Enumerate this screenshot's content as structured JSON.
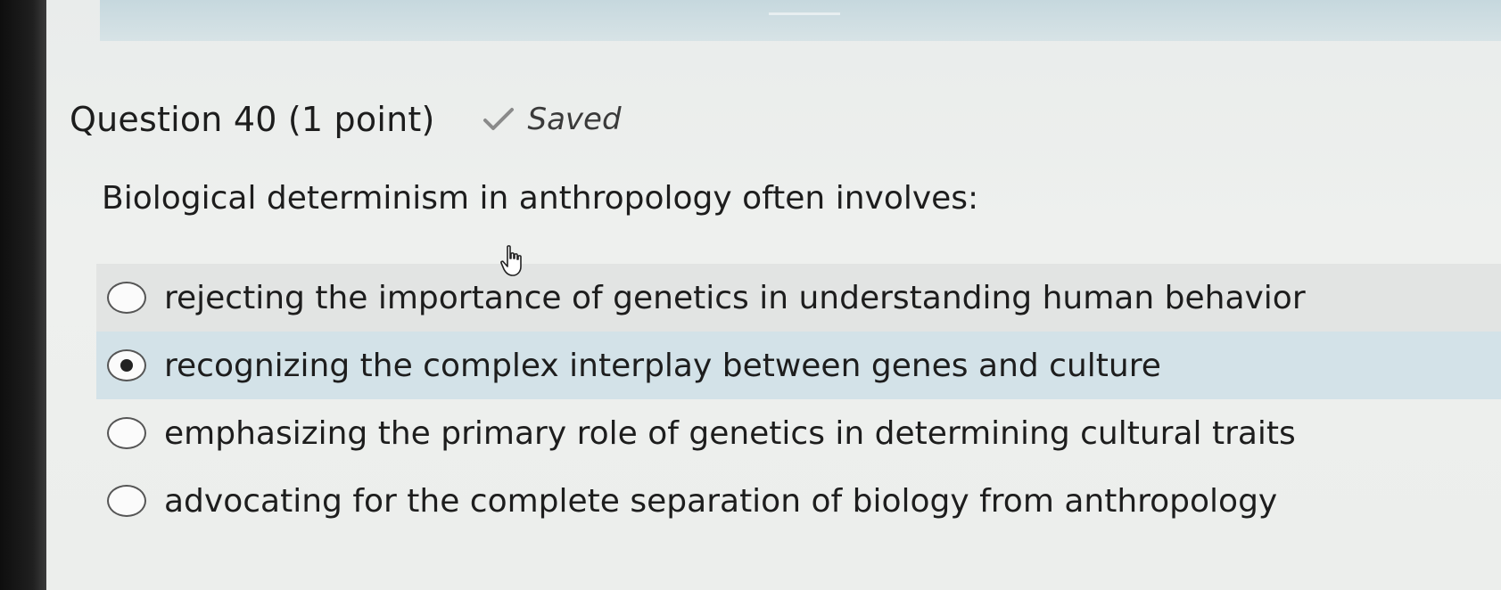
{
  "question": {
    "title": "Question 40 (1 point)",
    "status": "Saved",
    "status_icon": "checkmark-icon",
    "prompt": "Biological determinism in anthropology often involves:"
  },
  "options": [
    {
      "label": "rejecting the importance of genetics in understanding human behavior",
      "selected": false
    },
    {
      "label": "recognizing the complex interplay between genes and culture",
      "selected": true
    },
    {
      "label": "emphasizing the primary role of genetics in determining cultural traits",
      "selected": false
    },
    {
      "label": "advocating for the complete separation of biology from anthropology",
      "selected": false
    }
  ],
  "colors": {
    "selected_row": "#d3e2e8",
    "hover_row": "#e2e4e3",
    "text": "#1d1d1d"
  }
}
